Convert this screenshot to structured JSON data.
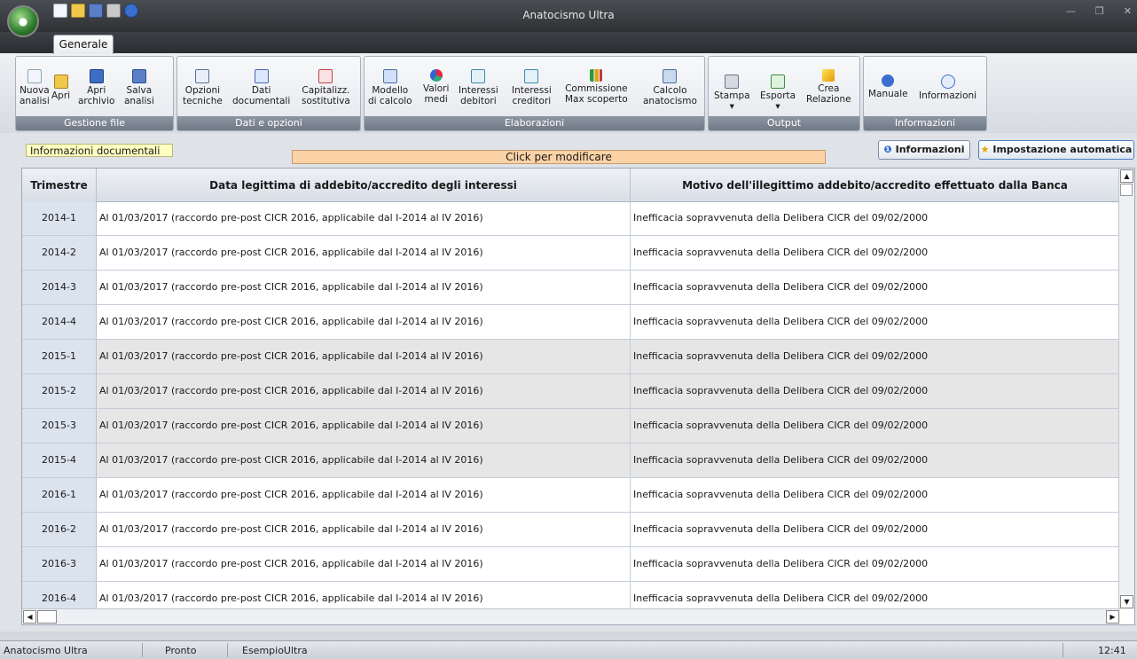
{
  "window": {
    "title": "Anatocismo Ultra"
  },
  "tabs": [
    {
      "label": "Generale"
    }
  ],
  "ribbon": {
    "groups": [
      {
        "label": "Gestione file",
        "buttons": [
          {
            "label1": "Nuova",
            "label2": "analisi",
            "icon": "new-document-icon"
          },
          {
            "label1": "Apri",
            "label2": "",
            "icon": "folder-open-icon"
          },
          {
            "label1": "Apri",
            "label2": "archivio",
            "icon": "archive-icon"
          },
          {
            "label1": "Salva",
            "label2": "analisi",
            "icon": "save-icon"
          }
        ]
      },
      {
        "label": "Dati e opzioni",
        "buttons": [
          {
            "label1": "Opzioni",
            "label2": "tecniche",
            "icon": "options-icon"
          },
          {
            "label1": "Dati",
            "label2": "documentali",
            "icon": "data-icon"
          },
          {
            "label1": "Capitalizz.",
            "label2": "sostitutiva",
            "icon": "calendar-icon"
          }
        ]
      },
      {
        "label": "Elaborazioni",
        "buttons": [
          {
            "label1": "Modello",
            "label2": "di calcolo",
            "icon": "model-icon"
          },
          {
            "label1": "Valori",
            "label2": "medi",
            "icon": "pie-chart-icon"
          },
          {
            "label1": "Interessi",
            "label2": "debitori",
            "icon": "debit-interest-icon"
          },
          {
            "label1": "Interessi",
            "label2": "creditori",
            "icon": "credit-interest-icon"
          },
          {
            "label1": "Commissione",
            "label2": "Max scoperto",
            "icon": "bar-chart-icon"
          },
          {
            "label1": "Calcolo",
            "label2": "anatocismo",
            "icon": "calculator-icon"
          }
        ]
      },
      {
        "label": "Output",
        "buttons": [
          {
            "label1": "Stampa",
            "label2": "",
            "icon": "print-icon"
          },
          {
            "label1": "Esporta",
            "label2": "",
            "icon": "export-icon"
          },
          {
            "label1": "Crea",
            "label2": "Relazione",
            "icon": "lightning-icon"
          }
        ]
      },
      {
        "label": "Informazioni",
        "buttons": [
          {
            "label1": "Manuale",
            "label2": "",
            "icon": "help-icon"
          },
          {
            "label1": "Informazioni",
            "label2": "",
            "icon": "info-icon"
          }
        ]
      }
    ]
  },
  "content": {
    "info_label": "Informazioni documentali",
    "click_label": "Click per modificare",
    "btn_info": "Informazioni",
    "btn_auto": "Impostazione automatica"
  },
  "grid": {
    "columns": [
      "Trimestre",
      "Data legittima di addebito/accredito degli interessi",
      "Motivo dell'illegittimo addebito/accredito effettuato dalla Banca"
    ],
    "rows": [
      {
        "trimestre": "2014-1",
        "data": "Al 01/03/2017 (raccordo pre-post CICR 2016, applicabile dal I-2014 al IV 2016)",
        "motivo": "Inefficacia sopravvenuta della Delibera CICR del 09/02/2000"
      },
      {
        "trimestre": "2014-2",
        "data": "Al 01/03/2017 (raccordo pre-post CICR 2016, applicabile dal I-2014 al IV 2016)",
        "motivo": "Inefficacia sopravvenuta della Delibera CICR del 09/02/2000"
      },
      {
        "trimestre": "2014-3",
        "data": "Al 01/03/2017 (raccordo pre-post CICR 2016, applicabile dal I-2014 al IV 2016)",
        "motivo": "Inefficacia sopravvenuta della Delibera CICR del 09/02/2000"
      },
      {
        "trimestre": "2014-4",
        "data": "Al 01/03/2017 (raccordo pre-post CICR 2016, applicabile dal I-2014 al IV 2016)",
        "motivo": "Inefficacia sopravvenuta della Delibera CICR del 09/02/2000"
      },
      {
        "trimestre": "2015-1",
        "data": "Al 01/03/2017 (raccordo pre-post CICR 2016, applicabile dal I-2014 al IV 2016)",
        "motivo": "Inefficacia sopravvenuta della Delibera CICR del 09/02/2000"
      },
      {
        "trimestre": "2015-2",
        "data": "Al 01/03/2017 (raccordo pre-post CICR 2016, applicabile dal I-2014 al IV 2016)",
        "motivo": "Inefficacia sopravvenuta della Delibera CICR del 09/02/2000"
      },
      {
        "trimestre": "2015-3",
        "data": "Al 01/03/2017 (raccordo pre-post CICR 2016, applicabile dal I-2014 al IV 2016)",
        "motivo": "Inefficacia sopravvenuta della Delibera CICR del 09/02/2000"
      },
      {
        "trimestre": "2015-4",
        "data": "Al 01/03/2017 (raccordo pre-post CICR 2016, applicabile dal I-2014 al IV 2016)",
        "motivo": "Inefficacia sopravvenuta della Delibera CICR del 09/02/2000"
      },
      {
        "trimestre": "2016-1",
        "data": "Al 01/03/2017 (raccordo pre-post CICR 2016, applicabile dal I-2014 al IV 2016)",
        "motivo": "Inefficacia sopravvenuta della Delibera CICR del 09/02/2000"
      },
      {
        "trimestre": "2016-2",
        "data": "Al 01/03/2017 (raccordo pre-post CICR 2016, applicabile dal I-2014 al IV 2016)",
        "motivo": "Inefficacia sopravvenuta della Delibera CICR del 09/02/2000"
      },
      {
        "trimestre": "2016-3",
        "data": "Al 01/03/2017 (raccordo pre-post CICR 2016, applicabile dal I-2014 al IV 2016)",
        "motivo": "Inefficacia sopravvenuta della Delibera CICR del 09/02/2000"
      },
      {
        "trimestre": "2016-4",
        "data": "Al 01/03/2017 (raccordo pre-post CICR 2016, applicabile dal I-2014 al IV 2016)",
        "motivo": "Inefficacia sopravvenuta della Delibera CICR del 09/02/2000"
      }
    ]
  },
  "statusbar": {
    "app": "Anatocismo Ultra",
    "state": "Pronto",
    "file": "EsempioUltra",
    "time": "12:41"
  },
  "colors": {
    "accent": "#4a7fbf",
    "highlight_orange": "#fcd3a6",
    "highlight_yellow": "#ffffc2"
  }
}
